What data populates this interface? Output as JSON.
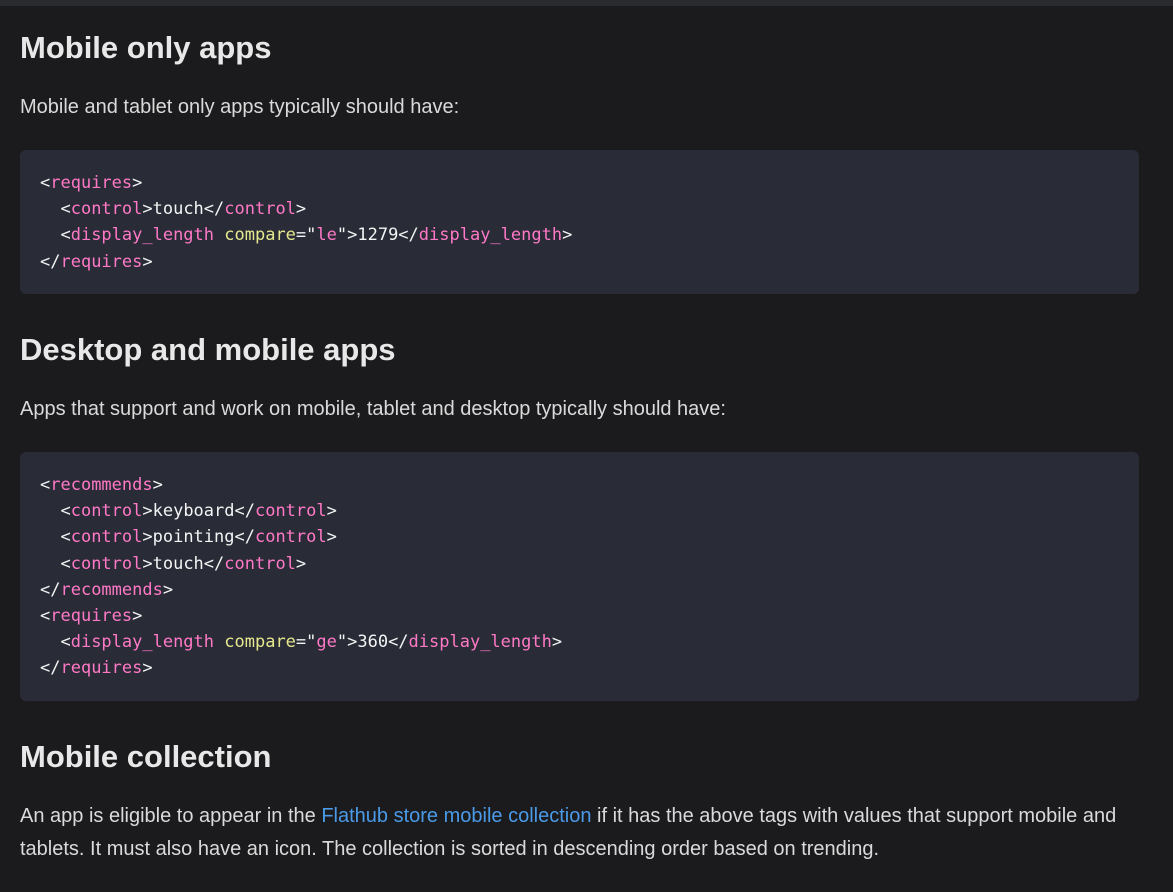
{
  "section1": {
    "heading": "Mobile only apps",
    "paragraph": "Mobile and tablet only apps typically should have:",
    "code_lines": [
      [
        [
          "p",
          "<"
        ],
        [
          "t",
          "requires"
        ],
        [
          "p",
          ">"
        ]
      ],
      [
        [
          "p",
          "  <"
        ],
        [
          "t",
          "control"
        ],
        [
          "p",
          ">touch</"
        ],
        [
          "t",
          "control"
        ],
        [
          "p",
          ">"
        ]
      ],
      [
        [
          "p",
          "  <"
        ],
        [
          "t",
          "display_length"
        ],
        [
          "p",
          " "
        ],
        [
          "a",
          "compare"
        ],
        [
          "p",
          "=\""
        ],
        [
          "s",
          "le"
        ],
        [
          "p",
          "\">1279</"
        ],
        [
          "t",
          "display_length"
        ],
        [
          "p",
          ">"
        ]
      ],
      [
        [
          "p",
          "</"
        ],
        [
          "t",
          "requires"
        ],
        [
          "p",
          ">"
        ]
      ]
    ]
  },
  "section2": {
    "heading": "Desktop and mobile apps",
    "paragraph": "Apps that support and work on mobile, tablet and desktop typically should have:",
    "code_lines": [
      [
        [
          "p",
          "<"
        ],
        [
          "t",
          "recommends"
        ],
        [
          "p",
          ">"
        ]
      ],
      [
        [
          "p",
          "  <"
        ],
        [
          "t",
          "control"
        ],
        [
          "p",
          ">keyboard</"
        ],
        [
          "t",
          "control"
        ],
        [
          "p",
          ">"
        ]
      ],
      [
        [
          "p",
          "  <"
        ],
        [
          "t",
          "control"
        ],
        [
          "p",
          ">pointing</"
        ],
        [
          "t",
          "control"
        ],
        [
          "p",
          ">"
        ]
      ],
      [
        [
          "p",
          "  <"
        ],
        [
          "t",
          "control"
        ],
        [
          "p",
          ">touch</"
        ],
        [
          "t",
          "control"
        ],
        [
          "p",
          ">"
        ]
      ],
      [
        [
          "p",
          "</"
        ],
        [
          "t",
          "recommends"
        ],
        [
          "p",
          ">"
        ]
      ],
      [
        [
          "p",
          "<"
        ],
        [
          "t",
          "requires"
        ],
        [
          "p",
          ">"
        ]
      ],
      [
        [
          "p",
          "  <"
        ],
        [
          "t",
          "display_length"
        ],
        [
          "p",
          " "
        ],
        [
          "a",
          "compare"
        ],
        [
          "p",
          "=\""
        ],
        [
          "s",
          "ge"
        ],
        [
          "p",
          "\">360</"
        ],
        [
          "t",
          "display_length"
        ],
        [
          "p",
          ">"
        ]
      ],
      [
        [
          "p",
          "</"
        ],
        [
          "t",
          "requires"
        ],
        [
          "p",
          ">"
        ]
      ]
    ]
  },
  "section3": {
    "heading": "Mobile collection",
    "paragraph_before_link": "An app is eligible to appear in the ",
    "link_text": "Flathub store mobile collection",
    "paragraph_after_link": " if it has the above tags with values that support mobile and tablets. It must also have an icon. The collection is sorted in descending order based on trending."
  },
  "colors": {
    "background": "#1b1b1d",
    "code_background": "#292b37",
    "tag": "#ff79c6",
    "attribute": "#e6e88e",
    "link": "#4a9ae8"
  }
}
